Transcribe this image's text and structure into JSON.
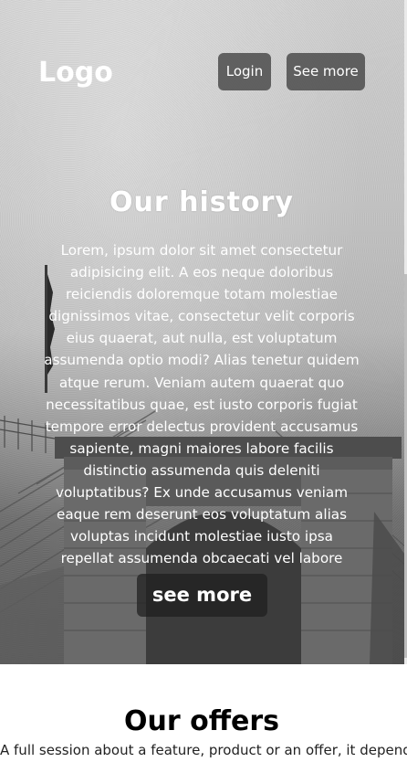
{
  "header": {
    "logo": "Logo",
    "login_label": "Login",
    "see_more_label": "See more"
  },
  "hero": {
    "title": "Our history",
    "text": "Lorem, ipsum dolor sit amet consectetur adipisicing elit. A eos neque doloribus reiciendis doloremque totam molestiae dignissimos vitae, consectetur velit corporis eius quaerat, aut nulla, est voluptatum assumenda optio modi? Alias tenetur quidem atque rerum. Veniam autem quaerat quo necessitatibus quae, est iusto corporis fugiat tempore error delectus provident accusamus sapiente, magni maiores labore facilis distinctio assumenda quis deleniti voluptatibus? Ex unde accusamus veniam eaque rem deserunt eos voluptatum alias voluptas incidunt molestiae iusto ipsa repellat assumenda obcaecati vel labore",
    "button_label": "see more"
  },
  "offers": {
    "title": "Our offers",
    "text": "A full session about a feature, product or an offer, it depends"
  }
}
